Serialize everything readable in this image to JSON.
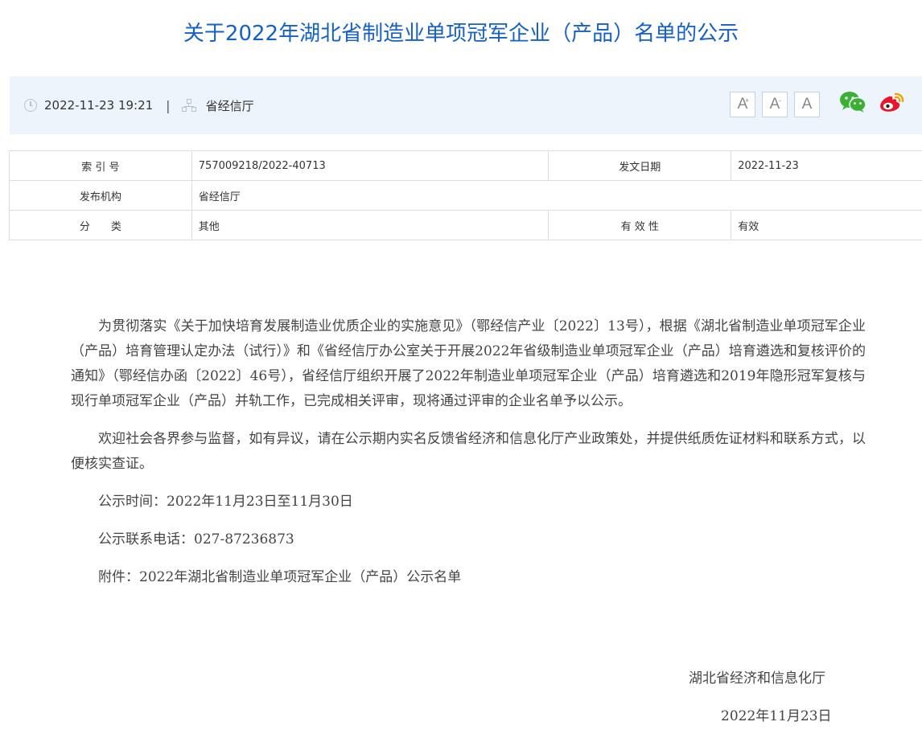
{
  "title": "关于2022年湖北省制造业单项冠军企业（产品）名单的公示",
  "meta": {
    "datetime": "2022-11-23 19:21",
    "separator": "|",
    "publisher": "省经信厅",
    "font_buttons": {
      "larger": "A",
      "smaller": "A",
      "reset": "A",
      "plus": "+",
      "minus": "-"
    }
  },
  "info_table": {
    "index_label": "索 引 号",
    "index_value": "757009218/2022-40713",
    "date_label": "发文日期",
    "date_value": "2022-11-23",
    "org_label": "发布机构",
    "org_value": "省经信厅",
    "category_label": "分　　类",
    "category_value": "其他",
    "validity_label": "有 效 性",
    "validity_value": "有效"
  },
  "body": {
    "p1": "为贯彻落实《关于加快培育发展制造业优质企业的实施意见》（鄂经信产业〔2022〕13号），根据《湖北省制造业单项冠军企业（产品）培育管理认定办法（试行）》和《省经信厅办公室关于开展2022年省级制造业单项冠军企业（产品）培育遴选和复核评价的通知》（鄂经信办函〔2022〕46号），省经信厅组织开展了2022年制造业单项冠军企业（产品）培育遴选和2019年隐形冠军复核与现行单项冠军企业（产品）并轨工作，已完成相关评审，现将通过评审的企业名单予以公示。",
    "p2": "欢迎社会各界参与监督，如有异议，请在公示期内实名反馈省经济和信息化厅产业政策处，并提供纸质佐证材料和联系方式，以便核实查证。",
    "p3": "公示时间：2022年11月23日至11月30日",
    "p4": "公示联系电话：027-87236873",
    "p5": "附件：2022年湖北省制造业单项冠军企业（产品）公示名单"
  },
  "signature": {
    "org": "湖北省经济和信息化厅",
    "date": "2022年11月23日"
  },
  "colors": {
    "title": "#1560c8",
    "metabar": "#eef4fb",
    "wechat": "#3cb034",
    "weibo": "#e6162d"
  }
}
